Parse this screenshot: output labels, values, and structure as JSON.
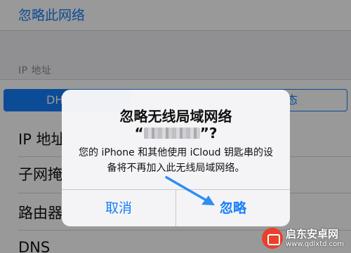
{
  "settings": {
    "forget_network_label": "忽略此网络",
    "ip_section_header": "IP 地址",
    "segment": [
      "DH",
      "",
      "态"
    ],
    "rows": [
      "IP 地址",
      "子网掩",
      "路由器",
      "DNS"
    ]
  },
  "alert": {
    "title": "忽略无线局域网络",
    "ssid_open": "“",
    "ssid_close": "”?",
    "message": "您的 iPhone 和其他使用 iCloud 钥匙串的设备将不再加入此无线局域网络。",
    "cancel_label": "取消",
    "ignore_label": "忽略"
  },
  "watermark": {
    "name": "启东安卓网",
    "url": "www.qdlxtd.com"
  },
  "colors": {
    "accent": "#157efb",
    "annotation_arrow": "#2f8ef2"
  }
}
